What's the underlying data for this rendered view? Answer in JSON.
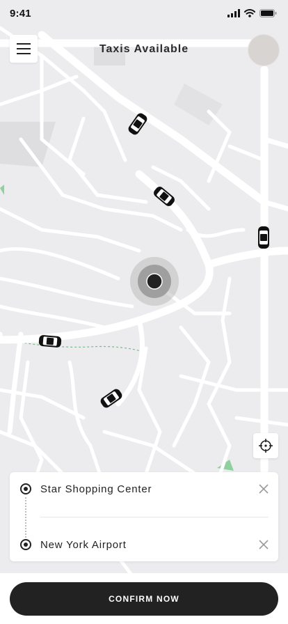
{
  "status_bar": {
    "time": "9:41"
  },
  "header": {
    "title": "Taxis Available"
  },
  "route": {
    "from": "Star Shopping Center",
    "to": "New York Airport"
  },
  "actions": {
    "confirm_label": "CONFIRM NOW"
  },
  "colors": {
    "accent": "#222222",
    "map_bg": "#ececee",
    "road": "#ffffff",
    "park": "#8fd19e"
  },
  "icons": [
    "menu-icon",
    "signal-icon",
    "wifi-icon",
    "battery-icon",
    "crosshair-icon",
    "close-icon",
    "car-icon",
    "location-marker"
  ]
}
